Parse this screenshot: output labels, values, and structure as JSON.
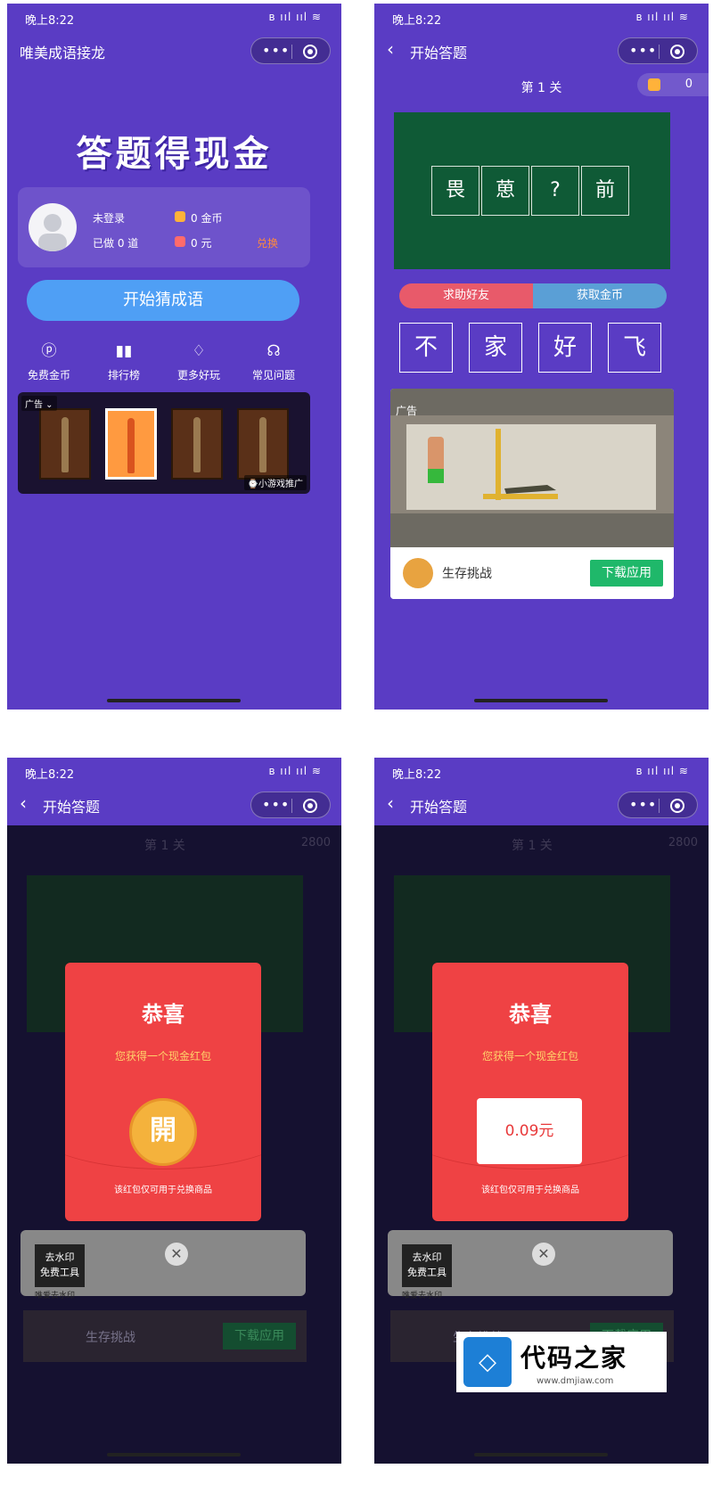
{
  "status": {
    "time": "晚上8:22",
    "icons": "ʙ ııl ııl ≋"
  },
  "p1": {
    "nav_title": "唯美成语接龙",
    "hero": "答题得现金",
    "user": {
      "name": "未登录",
      "done": "已做 0 道",
      "coins": "0 金币",
      "cash": "0 元",
      "exchange": "兑换"
    },
    "start": "开始猜成语",
    "menu": [
      {
        "label": "免费金币",
        "icon": "ⓟ"
      },
      {
        "label": "排行榜",
        "icon": "▮▮"
      },
      {
        "label": "更多好玩",
        "icon": "♢"
      },
      {
        "label": "常见问题",
        "icon": "☊"
      }
    ],
    "ad_tag": "广告 ⌄",
    "ad_foot": "⌚小游戏推广"
  },
  "p2": {
    "nav_title": "开始答题",
    "level": "第 1 关",
    "coins": "0",
    "tiles": [
      "畏",
      "葸",
      "?",
      "前"
    ],
    "help": "求助好友",
    "getcoin": "获取金币",
    "answers": [
      "不",
      "家",
      "好",
      "飞"
    ],
    "ad_tag": "广告",
    "ad_name": "生存挑战",
    "ad_btn": "下载应用"
  },
  "p3": {
    "nav_title": "开始答题",
    "level": "第 1 关",
    "coins": "2800",
    "title": "恭喜",
    "sub": "您获得一个现金红包",
    "open": "開",
    "note": "该红包仅可用于兑换商品",
    "wm_label": "去水印\n免费工具",
    "wm_name": "唯爱去水印",
    "close": "✕",
    "faint_ad": "生存挑战",
    "faint_btn": "下载应用"
  },
  "p4": {
    "nav_title": "开始答题",
    "level": "第 1 关",
    "coins": "2800",
    "title": "恭喜",
    "sub": "您获得一个现金红包",
    "amount": "0.09元",
    "note": "该红包仅可用于兑换商品",
    "wm_label": "去水印\n免费工具",
    "wm_name": "唯爱去水印",
    "close": "✕",
    "faint_ad": "生存挑战",
    "faint_btn": "下载应用"
  },
  "logo": {
    "mark": "◇",
    "title": "代码之家",
    "url": "www.dmjiaw.com"
  }
}
